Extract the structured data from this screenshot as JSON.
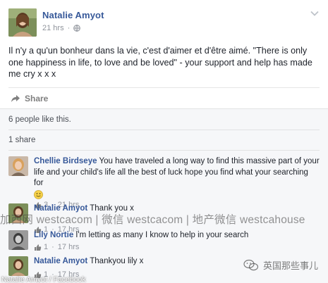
{
  "post": {
    "author": "Natalie Amyot",
    "time": "21 hrs",
    "privacy_icon": "globe-icon",
    "text": "Il n'y a qu'un bonheur dans la vie, c'est d'aimer et d'être aimé. \"There is only one happiness in life, to love and be loved\" - your support and help has made me cry x x x",
    "share_label": "Share"
  },
  "feedback": {
    "likes": "6 people like this.",
    "shares": "1 share"
  },
  "comments": [
    {
      "author": "Chellie Birdseye",
      "text": "You have traveled a long way to find this massive part of your life and your child's life all the best of luck hope you find what your searching for",
      "emoji": "smiley-icon",
      "likes": "3",
      "time": "21 hrs"
    },
    {
      "author": "Natalie Amyot",
      "text": "Thank you x",
      "likes": "1",
      "time": "17 hrs"
    },
    {
      "author": "Lily Nortie",
      "text": "I'm letting as many I know to help in your search",
      "likes": "1",
      "time": "17 hrs"
    },
    {
      "author": "Natalie Amyot",
      "text": "Thankyou lily x",
      "likes": "1",
      "time": "17 hrs"
    }
  ],
  "overlays": {
    "watermark": "加西网 westcacom | 微信 westcacom | 地产微信 westcahouse",
    "wechat_account": "英国那些事儿",
    "credit": "Natalie Amyot / Facebook"
  },
  "colors": {
    "link": "#365899",
    "text": "#1d2129",
    "meta": "#90949c",
    "section_bg": "#f6f7f9"
  }
}
